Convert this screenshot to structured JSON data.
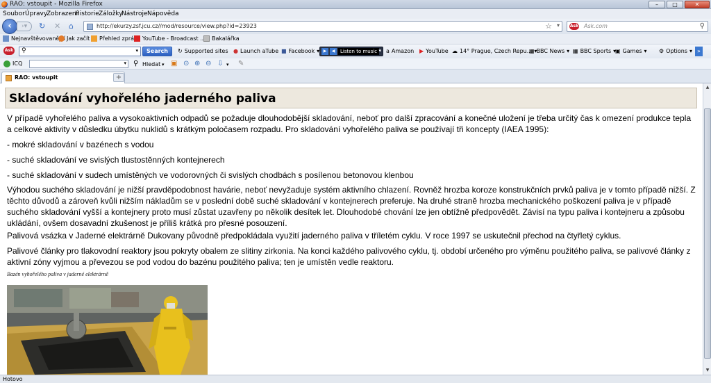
{
  "window": {
    "title": "RAO: vstoupit - Mozilla Firefox"
  },
  "menu": [
    "Soubor",
    "Úpravy",
    "Zobrazení",
    "Historie",
    "Záložky",
    "Nástroje",
    "Nápověda"
  ],
  "nav": {
    "url": "http://ekurzy.zsf.jcu.cz//mod/resource/view.php?id=23923",
    "search_placeholder": "Ask.com"
  },
  "bookmarks": [
    "Nejnavštěvovanější",
    "Jak začít",
    "Přehled zpráv",
    "YouTube - Broadcast ...",
    "Bakalářka"
  ],
  "ask_toolbar": {
    "search_button": "Search",
    "items": [
      "Supported sites",
      "Launch aTube",
      "Facebook",
      "Listen to music",
      "Amazon",
      "YouTube",
      "14° Prague, Czech Repu...",
      "BBC News",
      "BBC Sports",
      "Games",
      "Options"
    ]
  },
  "toolbar2": {
    "icq": "ICQ",
    "find": "Hledat"
  },
  "tab": {
    "label": "RAO: vstoupit"
  },
  "page": {
    "heading": "Skladování vyhořelého jaderného paliva",
    "p1": "V případě vyhořelého paliva a vysokoaktivních odpadů se požaduje dlouhodobější skladování, neboť pro další zpracování a konečné uložení je třeba určitý čas k omezení produkce tepla a celkové aktivity v důsledku úbytku nuklidů s krátkým poločasem rozpadu. Pro skladování vyhořelého paliva se používají tři koncepty (IAEA 1995):",
    "li1": "- mokré skladování v bazénech s vodou",
    "li2": "- suché skladování ve svislých tlustostěnných kontejnerech",
    "li3": "- suché skladování v sudech umístěných ve vodorovných či svislých chodbách s posílenou betonovou klenbou",
    "p2": "Výhodou suchého skladování je nižší pravděpodobnost havárie, neboť nevyžaduje systém aktivního chlazení. Rovněž hrozba koroze konstrukčních prvků paliva je v tomto případě nižší. Z těchto důvodů a zároveň kvůli nižším nákladům se v poslední době suché skladování v kontejnerech preferuje. Na druhé straně hrozba mechanického poškození paliva je v případě suchého skladování vyšší a kontejnery proto musí zůstat uzavřeny po několik desítek let. Dlouhodobé chování lze jen obtížně předpovědět. Závisí na typu paliva i kontejneru a způsobu ukládání, ovšem dosavadní zkušenost je příliš krátká pro přesné posouzení.",
    "p3": "Palivová vsázka v Jaderné elektrárně Dukovany původně předpokládala využití jaderného paliva v tříletém cyklu. V roce 1997 se uskutečnil přechod na čtyřletý cyklus.",
    "p4": "Palivové články pro tlakovodní reaktory jsou pokryty obalem ze slitiny zirkonia. Na konci každého palivového cyklu, tj. období určeného pro výměnu použitého paliva, se palivové články z aktivní zóny vyjmou a převezou se pod vodou do bazénu použitého paliva; ten je umístěn vedle reaktoru.",
    "caption": "Bazén vyhořelého paliva v jaderné elektrárně"
  },
  "status": "Hotovo",
  "colors": {
    "accent": "#3b78d0",
    "heading_bg": "#ede8de"
  }
}
